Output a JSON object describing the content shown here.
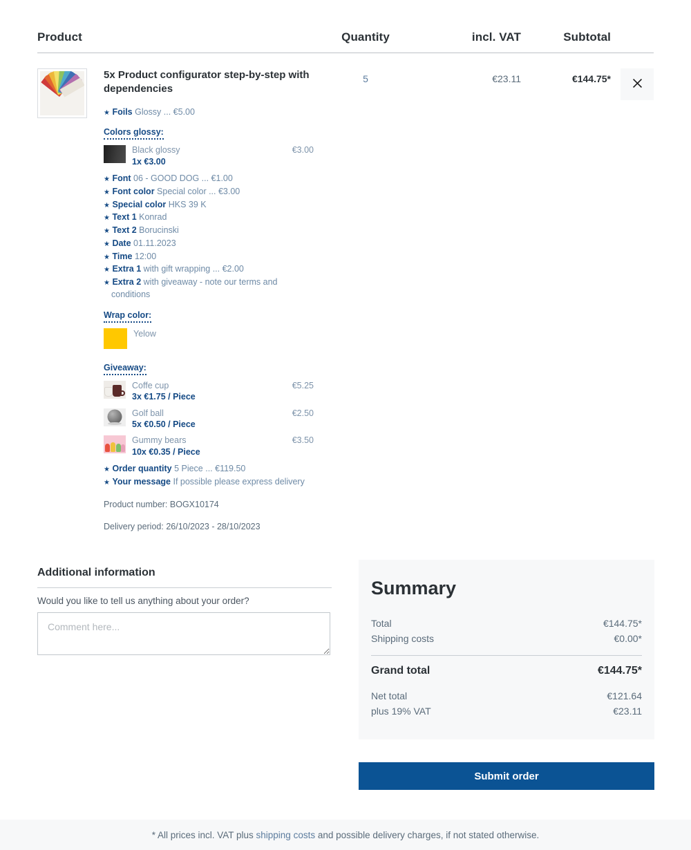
{
  "cart": {
    "headers": {
      "product": "Product",
      "quantity": "Quantity",
      "vat": "incl. VAT",
      "subtotal": "Subtotal"
    },
    "row": {
      "title": "5x Product configurator step-by-step with dependencies",
      "quantity": "5",
      "vat": "€23.11",
      "subtotal": "€144.75*",
      "remove_icon": "close-icon",
      "thumbnail_icon": "color-fan-swatch-image",
      "product_number": "Product number: BOGX10174",
      "delivery_period": "Delivery period: 26/10/2023 - 28/10/2023",
      "options_top": [
        {
          "label": "Foils",
          "value": "Glossy ... €5.00"
        }
      ],
      "colors_glossy": {
        "heading": "Colors glossy:",
        "items": [
          {
            "name": "Black glossy",
            "price": "€3.00",
            "qty_price": "1x €3.00",
            "swatch": "black-glossy-swatch"
          }
        ]
      },
      "options_mid": [
        {
          "label": "Font",
          "value": "06 - GOOD DOG ... €1.00"
        },
        {
          "label": "Font color",
          "value": "Special color ... €3.00"
        },
        {
          "label": "Special color",
          "value": "HKS 39 K"
        },
        {
          "label": "Text 1",
          "value": "Konrad"
        },
        {
          "label": "Text 2",
          "value": "Borucinski"
        },
        {
          "label": "Date",
          "value": "01.11.2023"
        },
        {
          "label": "Time",
          "value": "12:00"
        },
        {
          "label": "Extra 1",
          "value": "with gift wrapping ... €2.00"
        },
        {
          "label": "Extra 2",
          "value": "with giveaway - note our terms and conditions"
        }
      ],
      "wrap_color": {
        "heading": "Wrap color:",
        "items": [
          {
            "name": "Yelow",
            "price": "",
            "qty_price": "",
            "swatch": "yellow-swatch"
          }
        ]
      },
      "giveaway": {
        "heading": "Giveaway:",
        "items": [
          {
            "name": "Coffe cup",
            "price": "€5.25",
            "qty_price": "3x €1.75 / Piece",
            "swatch": "coffee-cup-image"
          },
          {
            "name": "Golf ball",
            "price": "€2.50",
            "qty_price": "5x €0.50 / Piece",
            "swatch": "golf-ball-image"
          },
          {
            "name": "Gummy bears",
            "price": "€3.50",
            "qty_price": "10x €0.35 / Piece",
            "swatch": "gummy-bears-image"
          }
        ]
      },
      "options_bottom": [
        {
          "label": "Order quantity",
          "value": "5 Piece ... €119.50"
        },
        {
          "label": "Your message",
          "value": "If possible please express delivery"
        }
      ]
    }
  },
  "additional_information": {
    "title": "Additional information",
    "question": "Would you like to tell us anything about your order?",
    "comment_placeholder": "Comment here...",
    "comment_value": ""
  },
  "summary": {
    "title": "Summary",
    "rows": [
      {
        "label": "Total",
        "value": "€144.75*"
      },
      {
        "label": "Shipping costs",
        "value": "€0.00*"
      }
    ],
    "grand": {
      "label": "Grand total",
      "value": "€144.75*"
    },
    "tax_rows": [
      {
        "label": "Net total",
        "value": "€121.64"
      },
      {
        "label": "plus 19% VAT",
        "value": "€23.11"
      }
    ],
    "submit_label": "Submit order"
  },
  "footer": {
    "prefix": "* All prices incl. VAT plus ",
    "link": "shipping costs",
    "suffix": " and possible delivery charges, if not stated otherwise."
  },
  "colors": {
    "accent": "#0b5394",
    "label_blue": "#154a85",
    "value_blue": "#6e8aa6",
    "panel_bg": "#f7f8f9",
    "yellow_swatch": "#ffc800"
  }
}
